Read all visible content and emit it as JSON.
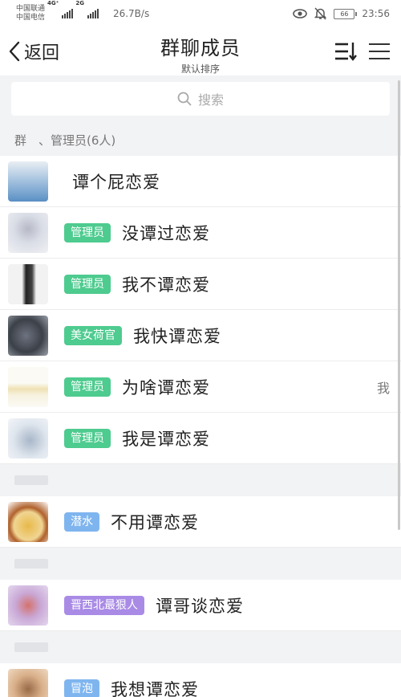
{
  "status": {
    "carrier1": "中国联通",
    "carrier2": "中国电信",
    "net1": "4G⁺",
    "net2": "2G",
    "speed": "26.7B/s",
    "battery": "66",
    "time": "23:56"
  },
  "header": {
    "back_label": "返回",
    "title": "群聊成员",
    "subtitle": "默认排序"
  },
  "search": {
    "placeholder": "搜索"
  },
  "sections": {
    "admins": "群　、管理员(6人)"
  },
  "members": [
    {
      "name": "谭个屁恋爱",
      "badge": "",
      "avatar_colors": [
        "#a8c5e0",
        "#5a8fc4",
        "#e9eef3"
      ]
    },
    {
      "name": "没谭过恋爱",
      "badge": "管理员",
      "avatar_colors": [
        "#d9dde6",
        "#b7b9c6",
        "#f0f0f3"
      ]
    },
    {
      "name": "我不谭恋爱",
      "badge": "管理员",
      "avatar_colors": [
        "#f2f2f2",
        "#222222",
        "#9b9b9b"
      ]
    },
    {
      "name": "我快谭恋爱",
      "badge": "美女荷官",
      "avatar_colors": [
        "#3c4048",
        "#6d7380",
        "#9aa0aa"
      ]
    },
    {
      "name": "为啥谭恋爱",
      "badge": "管理员",
      "avatar_colors": [
        "#fbfaf4",
        "#efe1b4",
        "#f7f1df"
      ],
      "side": "我"
    },
    {
      "name": "我是谭恋爱",
      "badge": "管理员",
      "avatar_colors": [
        "#dfe6ee",
        "#a9b7c9",
        "#f3f5f8"
      ]
    },
    {
      "name": "不用谭恋爱",
      "badge": "潜水",
      "avatar_colors": [
        "#e7b94a",
        "#b0612c",
        "#f0d592"
      ]
    },
    {
      "name": "谭哥谈恋爱",
      "badge": "晋西北最狠人",
      "avatar_colors": [
        "#c9a8d6",
        "#d4726e",
        "#e4d7ee"
      ]
    },
    {
      "name": "我想谭恋爱",
      "badge": "冒泡",
      "avatar_colors": [
        "#d9b08a",
        "#9a6b48",
        "#efd9c2"
      ]
    }
  ]
}
